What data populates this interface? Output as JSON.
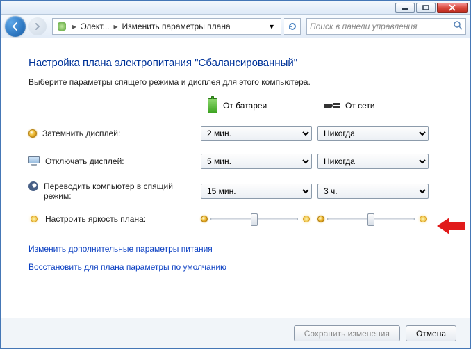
{
  "breadcrumb": {
    "seg1": "Элект...",
    "seg2": "Изменить параметры плана"
  },
  "search": {
    "placeholder": "Поиск в панели управления"
  },
  "heading": "Настройка плана электропитания \"Сбалансированный\"",
  "subheading": "Выберите параметры спящего режима и дисплея для этого компьютера.",
  "col_battery": "От батареи",
  "col_ac": "От сети",
  "row_dim": "Затемнить дисплей:",
  "row_off": "Отключать дисплей:",
  "row_sleep": "Переводить компьютер в спящий режим:",
  "row_bright": "Настроить яркость плана:",
  "values": {
    "dim_battery": "2 мин.",
    "dim_ac": "Никогда",
    "off_battery": "5 мин.",
    "off_ac": "Никогда",
    "sleep_battery": "15 мин.",
    "sleep_ac": "3 ч."
  },
  "link_advanced": "Изменить дополнительные параметры питания",
  "link_restore": "Восстановить для плана параметры по умолчанию",
  "btn_save": "Сохранить изменения",
  "btn_cancel": "Отмена"
}
